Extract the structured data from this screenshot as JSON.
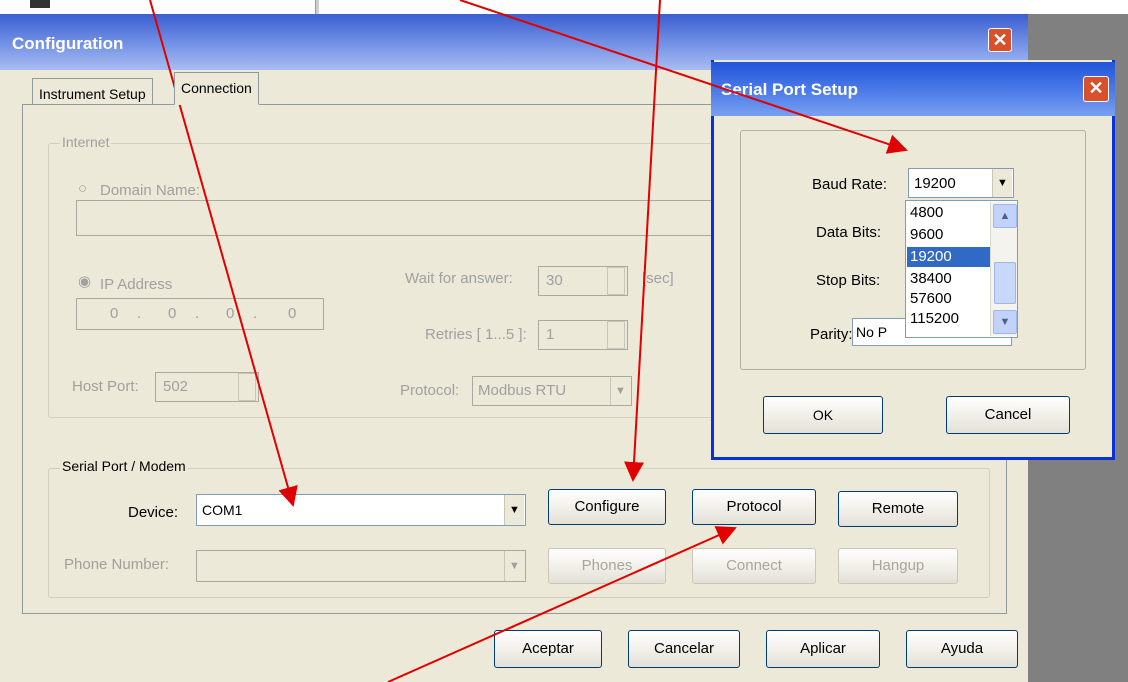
{
  "window": {
    "title": "Configuration"
  },
  "tabs": [
    {
      "label": "Instrument Setup"
    },
    {
      "label": "Connection"
    }
  ],
  "internet": {
    "group_label": "Internet",
    "domain_name_label": "Domain Name:",
    "ip_address_label": "IP Address",
    "ip_octets": [
      "0",
      "0",
      "0",
      "0"
    ],
    "wait_label": "Wait for answer:",
    "wait_value": "30",
    "wait_unit": "[sec]",
    "retries_label": "Retries [ 1...5 ]:",
    "retries_value": "1",
    "host_port_label": "Host Port:",
    "host_port_value": "502",
    "protocol_label": "Protocol:",
    "protocol_value": "Modbus RTU"
  },
  "serial_modem": {
    "group_label": "Serial Port / Modem",
    "device_label": "Device:",
    "device_value": "COM1",
    "phone_label": "Phone Number:",
    "buttons": {
      "configure": "Configure",
      "protocol": "Protocol",
      "remote": "Remote",
      "phones": "Phones",
      "connect": "Connect",
      "hangup": "Hangup"
    }
  },
  "footer_buttons": {
    "accept": "Aceptar",
    "cancel": "Cancelar",
    "apply": "Aplicar",
    "help": "Ayuda"
  },
  "serial_setup": {
    "title": "Serial Port Setup",
    "baud_label": "Baud Rate:",
    "baud_value": "19200",
    "data_bits_label": "Data Bits:",
    "stop_bits_label": "Stop Bits:",
    "parity_label": "Parity:",
    "parity_value_partial": "No P",
    "baud_options": [
      "4800",
      "9600",
      "19200",
      "38400",
      "57600",
      "115200"
    ],
    "selected_option": "19200",
    "ok": "OK",
    "cancel": "Cancel"
  },
  "icons": {
    "close": "close-icon",
    "dropdown": "chevron-down-icon",
    "spin": "spin-arrows-icon",
    "scroll_up": "scroll-up-icon",
    "scroll_down": "scroll-down-icon"
  },
  "colors": {
    "titlebar": "#3a5fd0",
    "close": "#d9512c",
    "selection": "#316ac5",
    "annotation_arrow": "#e00000"
  }
}
